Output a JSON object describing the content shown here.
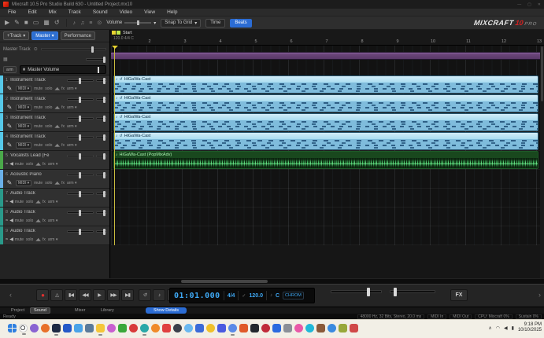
{
  "window": {
    "title": "Mixcraft 10.5 Pro Studio Build 630 - Untitled Project.mx10",
    "logo_text": "MIXCRAFT",
    "logo_version": "10",
    "logo_suffix": "PRO"
  },
  "menu": {
    "items": [
      "File",
      "Edit",
      "Mix",
      "Track",
      "Sound",
      "Video",
      "View",
      "Help"
    ]
  },
  "toolbar": {
    "volume": "Volume",
    "snap": "Snap To Grid",
    "time": "Time",
    "beats": "Beats"
  },
  "left_panel": {
    "add_track": "+Track",
    "master": "Master",
    "performance": "Performance",
    "master_track": "Master Track",
    "arm": "arm",
    "master_volume": "Master Volume",
    "buttons": {
      "midi": "MIDI",
      "mute": "mute",
      "solo": "solo",
      "fx": "fx",
      "arm": "arm"
    },
    "tracks": [
      {
        "num": "1",
        "name": "Instrument Track"
      },
      {
        "num": "2",
        "name": "Instrument Track"
      },
      {
        "num": "3",
        "name": "Instrument Track"
      },
      {
        "num": "4",
        "name": "Instrument Track"
      },
      {
        "num": "5",
        "name": "Vocalists Lead (Fe"
      },
      {
        "num": "6",
        "name": "Acoustic Piano"
      },
      {
        "num": "7",
        "name": "Audio Track"
      },
      {
        "num": "8",
        "name": "Audio Track"
      },
      {
        "num": "9",
        "name": "Audio Track"
      }
    ]
  },
  "timeline": {
    "start_marker": "Start",
    "position_info": "120.0 4/4 C",
    "ruler": [
      2,
      3,
      4,
      5,
      6,
      7,
      8,
      9,
      10,
      11,
      12,
      13
    ],
    "midi_clip_name": "HiGaWa-Cast",
    "audio_clip_name": "HiGaWa-Cast (PopMixAdv)"
  },
  "transport": {
    "time": "01:01.000",
    "time_sig": "4/4",
    "tempo": "120.0",
    "key": "C",
    "mode": "CHROM",
    "fx": "FX"
  },
  "bottom_bar": {
    "tabs": [
      "Project",
      "Sound",
      "Mixer",
      "Library"
    ],
    "show_button": "Show Details"
  },
  "status_bar": {
    "ready": "Ready",
    "audio_format": "48000 Hz, 32 Bits, Stereo, 20.0 ms",
    "midi_in": "MIDI In",
    "midi_out": "MIDI Out",
    "cpu": "CPU: Mixcraft 0%",
    "sustain": "Sustain 0%"
  },
  "taskbar": {
    "time": "9:18 PM",
    "date": "10/10/2025"
  },
  "colors": {
    "accent_blue": "#2b6cd4",
    "record_red": "#e03030",
    "midi_clip": "#8ec9e4",
    "audio_clip_wave": "#46c268",
    "master_lane_purple": "#6a4579",
    "taskbar_bg": "#f2efe6"
  },
  "icons": {
    "pencil": "✎",
    "wave": "≈",
    "speaker": "◀",
    "knobs": "◢◣",
    "dropdown": "▾",
    "record": "●",
    "metronome": "△",
    "to_start": "▮◀",
    "rewind": "◀◀",
    "play": "▶",
    "forward": "▶▶",
    "to_end": "▶▮",
    "loop": "↺",
    "note": "♪",
    "punch": "‖",
    "check": "✓",
    "prev": "‹",
    "next": "›",
    "minimize": "—",
    "maximize": "▢",
    "close": "✕",
    "gear": "⊙",
    "list": "≡",
    "note2": "♫",
    "toolbar": [
      "▶",
      "✎",
      "■",
      "▭",
      "▦",
      "↺"
    ]
  }
}
